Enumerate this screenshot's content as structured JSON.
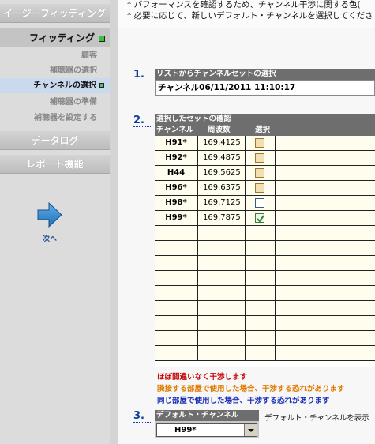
{
  "sidebar": {
    "buttons": [
      "イージーフィッティング",
      "フィッティング",
      "データログ",
      "レポート機能"
    ],
    "sub_items": [
      "顧客",
      "補聴器の選択",
      "チャンネルの選択",
      "補聴器の準備",
      "補聴器を設定する"
    ],
    "next_label": "次へ"
  },
  "main": {
    "notes": [
      "* パフォーマンスを確認するため、チャンネル干渉に関する色(",
      "* 必要に応じて、新しいデフォルト・チャンネルを選択してくださ"
    ],
    "steps": [
      "1.",
      "2.",
      "3."
    ],
    "section1": {
      "header": "リストからチャンネルセットの選択",
      "value": "チャンネル06/11/2011 11:10:17"
    },
    "section2": {
      "header": "選択したセットの確認",
      "columns": [
        "チャンネル",
        "周波数",
        "選択"
      ],
      "rows": [
        {
          "channel": "H91*",
          "freq": "169.4125",
          "state": "orange"
        },
        {
          "channel": "H92*",
          "freq": "169.4875",
          "state": "orange"
        },
        {
          "channel": "H44",
          "freq": "169.5625",
          "state": "orange"
        },
        {
          "channel": "H96*",
          "freq": "169.6375",
          "state": "orange"
        },
        {
          "channel": "H98*",
          "freq": "169.7125",
          "state": "plain"
        },
        {
          "channel": "H99*",
          "freq": "169.7875",
          "state": "checked"
        }
      ]
    },
    "legend": [
      {
        "text": "ほぼ間違いなく干渉します",
        "color": "#c80000"
      },
      {
        "text": "隣接する部屋で使用した場合、干渉する恐れがあります",
        "color": "#e07a00"
      },
      {
        "text": "同じ部屋で使用した場合、干渉する恐れがあります",
        "color": "#1a2fb8"
      }
    ],
    "section3": {
      "header": "デフォルト・チャンネル",
      "value": "H99*",
      "label": "デフォルト・チャンネルを表示"
    }
  }
}
